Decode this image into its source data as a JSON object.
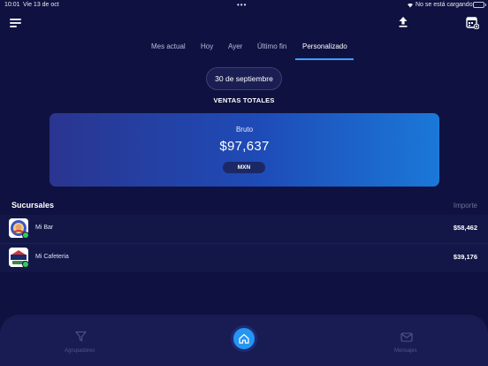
{
  "status_bar": {
    "time": "10:01",
    "date": "Vie 13 de oct",
    "charging_text": "No se está cargando"
  },
  "tabs": [
    {
      "label": "Mes actual",
      "active": false
    },
    {
      "label": "Hoy",
      "active": false
    },
    {
      "label": "Ayer",
      "active": false
    },
    {
      "label": "Último fin",
      "active": false
    },
    {
      "label": "Personalizado",
      "active": true
    }
  ],
  "date_selector": {
    "value": "30 de septiembre"
  },
  "summary": {
    "title": "VENTAS TOTALES",
    "gross_label": "Bruto",
    "amount": "$97,637",
    "currency": "MXN"
  },
  "branches": {
    "title": "Sucursales",
    "amount_header": "Importe",
    "items": [
      {
        "name": "Mi Bar",
        "amount": "$58,462"
      },
      {
        "name": "Mi Cafeteria",
        "amount": "$39,176"
      }
    ]
  },
  "bottom_nav": {
    "items": [
      {
        "label": "Agrupadores",
        "icon": "funnel-icon"
      },
      {
        "label": "",
        "icon": "home-icon"
      },
      {
        "label": "Mensajes",
        "icon": "envelope-icon"
      }
    ]
  },
  "colors": {
    "background": "#0f1240",
    "accent": "#3ea0ff",
    "card_start": "#2a3590",
    "card_end": "#1b78d8",
    "status_green": "#2ecc5c"
  }
}
